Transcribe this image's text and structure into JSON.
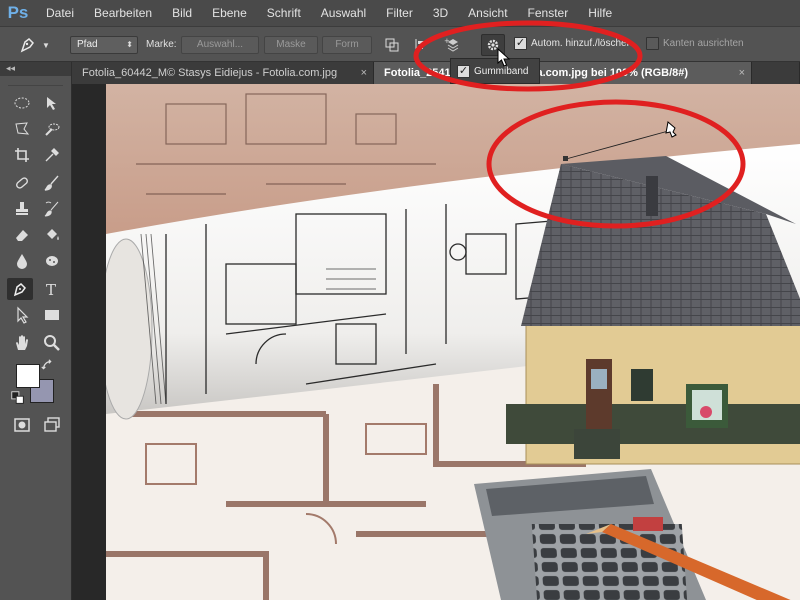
{
  "app": {
    "logo": "Ps"
  },
  "menu": [
    "Datei",
    "Bearbeiten",
    "Bild",
    "Ebene",
    "Schrift",
    "Auswahl",
    "Filter",
    "3D",
    "Ansicht",
    "Fenster",
    "Hilfe"
  ],
  "options": {
    "mode_value": "Pfad",
    "marke_label": "Marke:",
    "auswahl_button": "Auswahl...",
    "maske_button": "Maske",
    "form_button": "Form",
    "auto_add_label": "Autom. hinzuf./löschen",
    "auto_add_checked": true,
    "align_edges_label": "Kanten ausrichten",
    "align_edges_checked": false
  },
  "popup": {
    "rubber_band_label": "Gummiband",
    "rubber_band_checked": true
  },
  "toolbar": {
    "collapse_label": "◂◂",
    "fg_color": "#ffffff",
    "bg_color": "#9596b0"
  },
  "tabs": [
    {
      "label": "Fotolia_60442_M© Stasys Eidiejus - Fotolia.com.jpg",
      "active": false
    },
    {
      "label": "Fotolia_2541",
      "active": true
    },
    {
      "label": "5 - Fotolia.com.jpg bei 100% (RGB/8#)",
      "active": true
    }
  ],
  "colors": {
    "highlight_ellipse": "#e02020",
    "accent_ps": "#6fb0e8"
  }
}
